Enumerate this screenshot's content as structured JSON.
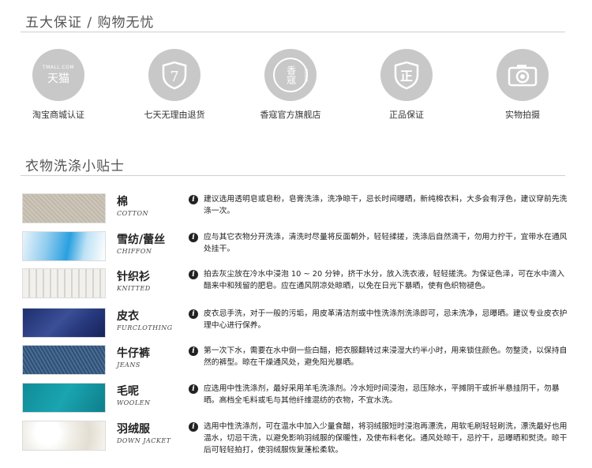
{
  "header1": "五大保证 / 购物无忧",
  "guarantees": [
    {
      "label": "淘宝商城认证",
      "icon": "tmall-icon",
      "badge_top": "TMALL.COM",
      "badge_main": "天猫"
    },
    {
      "label": "七天无理由退货",
      "icon": "seven-day-shield-icon",
      "badge_main": "7"
    },
    {
      "label": "香寇官方旗舰店",
      "icon": "brand-logo-icon",
      "badge_main": "香寇",
      "badge_side": "CEBLO"
    },
    {
      "label": "正品保证",
      "icon": "genuine-shield-icon",
      "badge_main": "正"
    },
    {
      "label": "实物拍摄",
      "icon": "camera-icon"
    }
  ],
  "header2": "衣物洗涤小贴士",
  "fabrics": [
    {
      "name_cn": "棉",
      "name_en": "COTTON",
      "desc": "建议选用透明皂或皂粉，皂膏洗涤，洗净晾干，忌长时间曝晒，新纯棉衣料，大多会有浮色，建议穿前先洗涤一次。"
    },
    {
      "name_cn": "雪纺/蕾丝",
      "name_en": "CHIFFON",
      "desc": "应与其它衣物分开洗涤，清洗时尽量将反面朝外，轻轻揉搓，洗涤后自然滴干，勿用力拧干，宜带水在通风处挂干。"
    },
    {
      "name_cn": "针织衫",
      "name_en": "KNITTED",
      "desc": "拍去灰尘放在冷水中浸泡 10 ~ 20 分钟，挤干水分，放入洗衣液，轻轻搓洗。为保证色泽，可在水中滴入醋来中和残留的肥皂。应在通风阴凉处晾晒，以免在日光下暴晒，使有色织物褪色。"
    },
    {
      "name_cn": "皮衣",
      "name_en": "FURCLOTHING",
      "desc": "皮衣忌手洗，对于一般的污垢，用皮革清洁剂或中性洗涤剂洗涤即可，忌未洗净，忌曝晒。建议专业皮衣护理中心进行保养。"
    },
    {
      "name_cn": "牛仔裤",
      "name_en": "JEANS",
      "desc": "第一次下水，需要在水中倒一些白醋，把衣服翻转过来浸湿大约半小时，用来锁住颜色。勿整烫，以保持自然的裤型。晾在干燥通风处，避免阳光暴晒。"
    },
    {
      "name_cn": "毛呢",
      "name_en": "WOOLEN",
      "desc": "应选用中性洗涤剂，最好采用羊毛洗涤剂。冷水短时间浸泡，忌压除水，平摊阴干或折半悬挂阴干，勿暴晒。高档全毛料或毛与其他纤维混纺的衣物，不宜水洗。"
    },
    {
      "name_cn": "羽绒服",
      "name_en": "DOWN JACKET",
      "desc": "选用中性洗涤剂，可在温水中加入少量食醋，将羽绒服短时浸泡再漂洗，用软毛刷轻轻刷洗，漂洗最好也用温水，切忌干洗，以避免影响羽绒服的保暖性，及使布料老化。通风处晾干，忌拧干，忌曝晒和熨烫。晾干后可轻轻拍打，使羽绒服恢复蓬松柔软。"
    }
  ],
  "info_icon_glyph": "i"
}
